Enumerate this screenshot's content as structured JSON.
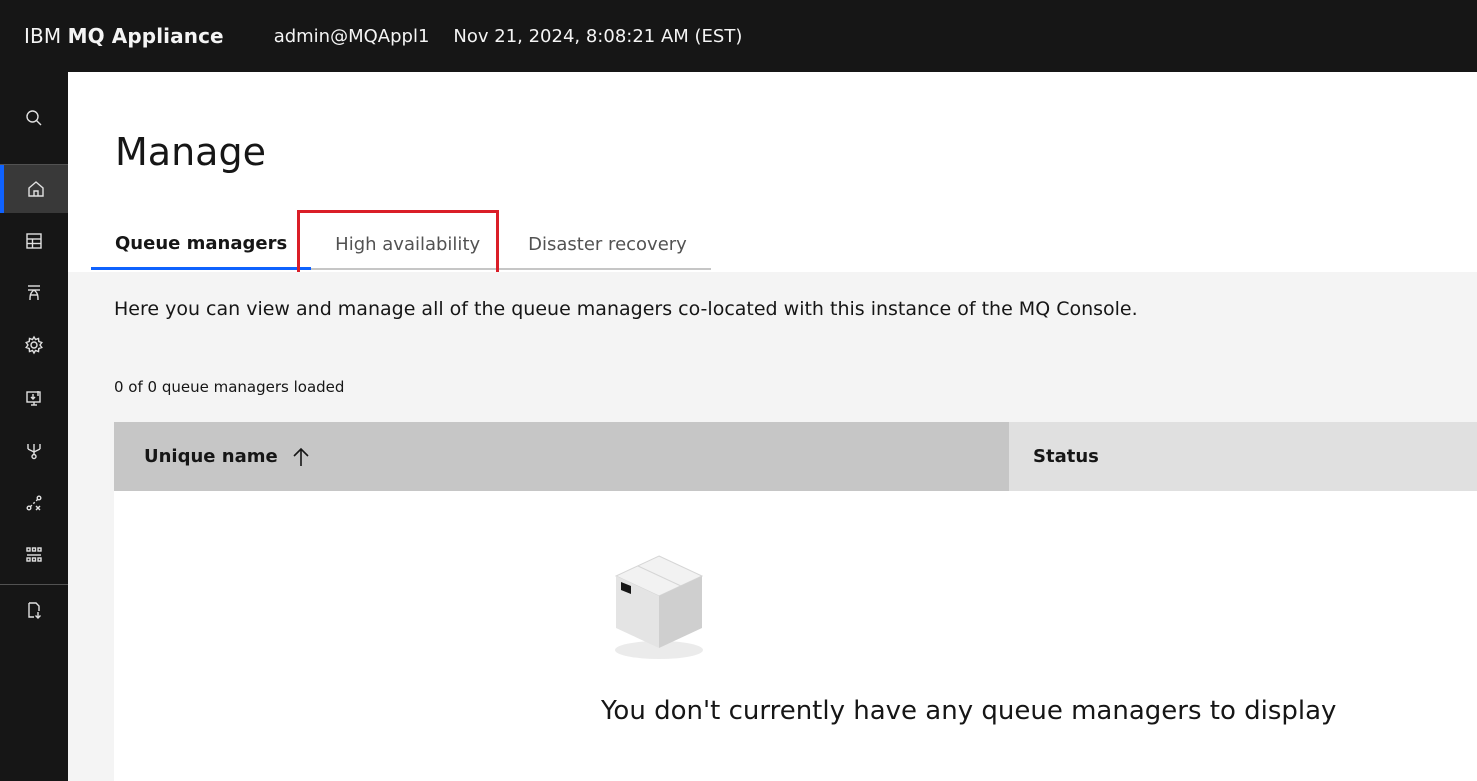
{
  "header": {
    "brand_prefix": "IBM ",
    "brand_product": "MQ Appliance",
    "user": "admin@MQAppl1",
    "datetime": "Nov 21, 2024, 8:08:21 AM (EST)"
  },
  "rail": {
    "items": [
      {
        "icon": "search-icon"
      },
      {
        "icon": "home-icon",
        "active": true
      },
      {
        "icon": "table-icon"
      },
      {
        "icon": "network-icon"
      },
      {
        "icon": "settings-icon"
      },
      {
        "icon": "monitor-icon"
      },
      {
        "icon": "routing-icon"
      },
      {
        "icon": "connections-icon"
      },
      {
        "icon": "apps-grid-icon"
      },
      {
        "icon": "export-icon"
      }
    ]
  },
  "page": {
    "title": "Manage",
    "tabs": [
      {
        "label": "Queue managers",
        "selected": true
      },
      {
        "label": "High availability",
        "selected": false,
        "highlighted": true
      },
      {
        "label": "Disaster recovery",
        "selected": false
      }
    ],
    "description": "Here you can view and manage all of the queue managers co-located with this instance of the MQ Console.",
    "count_text": "0 of 0 queue managers loaded"
  },
  "table": {
    "columns": [
      "Unique name",
      "Status"
    ],
    "sort_icon": "arrow-up-icon",
    "rows": [],
    "empty_message": "You don't currently have any queue managers to display"
  },
  "colors": {
    "header_bg": "#161616",
    "accent": "#0f62fe",
    "highlight": "#da1e28",
    "content_bg": "#f4f4f4"
  }
}
